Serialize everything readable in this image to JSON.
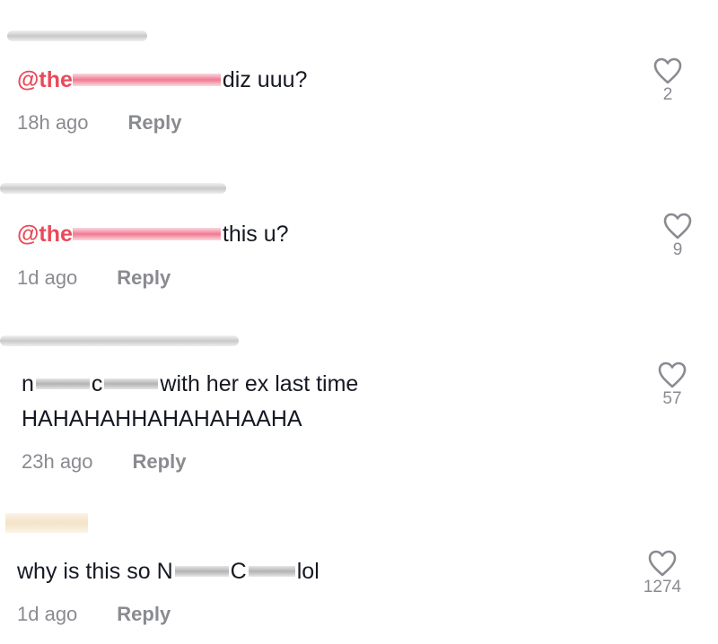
{
  "comments": [
    {
      "mention": "@the",
      "text": "diz uuu?",
      "time": "18h ago",
      "reply": "Reply",
      "likes": "2"
    },
    {
      "mention": "@the",
      "text": "this u?",
      "time": "1d ago",
      "reply": "Reply",
      "likes": "9"
    },
    {
      "text_a": "n",
      "text_b": "c",
      "text_c": "with her ex last time",
      "text_line2": "HAHAHAHHAHAHAHAAHA",
      "time": "23h ago",
      "reply": "Reply",
      "likes": "57"
    },
    {
      "text_a": "why is this so N",
      "text_b": "C",
      "text_c": "lol",
      "time": "1d ago",
      "reply": "Reply",
      "likes": "1274"
    }
  ],
  "icons": {
    "like": "heart-outline-icon"
  },
  "colors": {
    "mention": "#e94a5a",
    "meta": "#8a8b91",
    "text": "#161823"
  }
}
